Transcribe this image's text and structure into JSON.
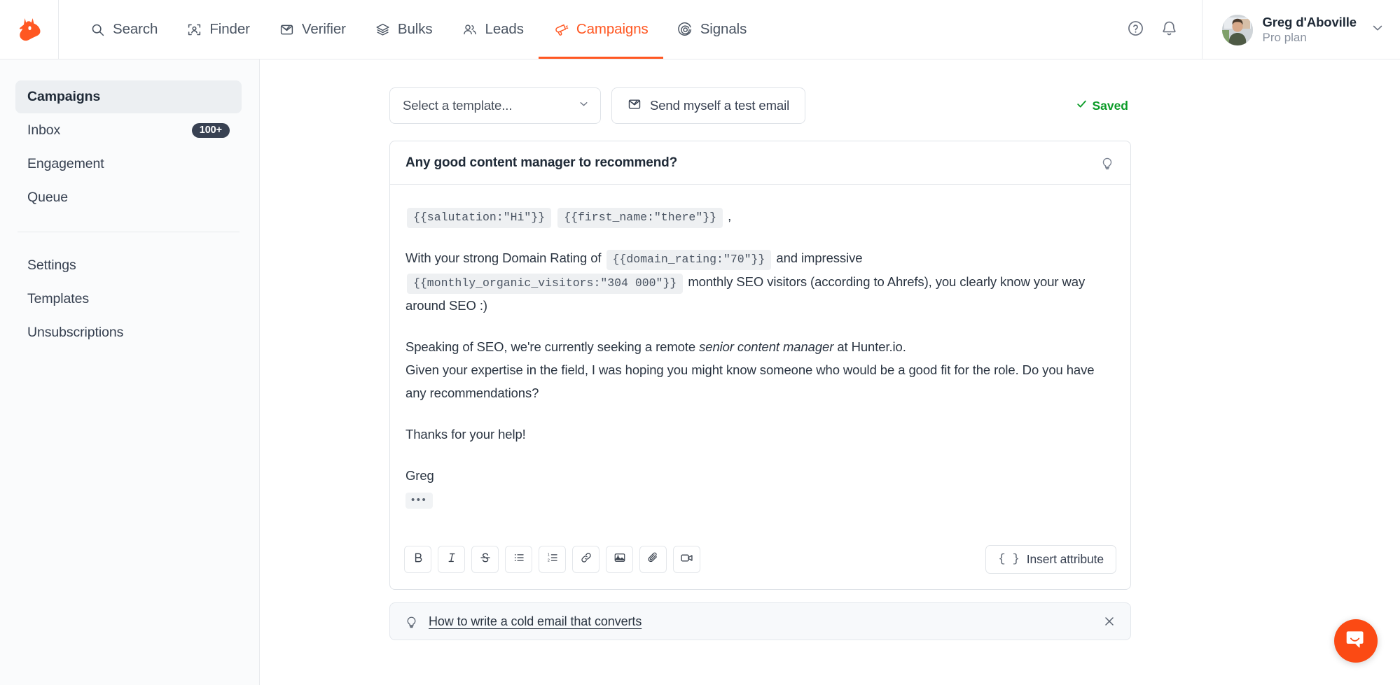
{
  "brand": {
    "name": "Hunter",
    "logo_icon": "hunter-fox-logo",
    "color": "#ff5722"
  },
  "topnav": {
    "items": [
      {
        "label": "Search",
        "icon": "search-icon"
      },
      {
        "label": "Finder",
        "icon": "person-frame-icon"
      },
      {
        "label": "Verifier",
        "icon": "envelope-check-icon"
      },
      {
        "label": "Bulks",
        "icon": "layers-icon"
      },
      {
        "label": "Leads",
        "icon": "people-icon"
      },
      {
        "label": "Campaigns",
        "icon": "megaphone-icon",
        "active": true
      },
      {
        "label": "Signals",
        "icon": "radar-icon"
      }
    ],
    "help_icon": "question-circle-icon",
    "notifications_icon": "bell-icon",
    "user": {
      "name": "Greg d'Aboville",
      "plan": "Pro plan",
      "avatar_icon": "user-avatar",
      "chevron_icon": "chevron-down-icon"
    }
  },
  "sidebar": {
    "items": [
      {
        "label": "Campaigns",
        "active": true
      },
      {
        "label": "Inbox",
        "badge": "100+"
      },
      {
        "label": "Engagement"
      },
      {
        "label": "Queue"
      }
    ],
    "items2": [
      {
        "label": "Settings"
      },
      {
        "label": "Templates"
      },
      {
        "label": "Unsubscriptions"
      }
    ]
  },
  "toolbar": {
    "template_select_value": "Select a template...",
    "template_select_chevron": "chevron-down-icon",
    "test_email_label": "Send myself a test email",
    "test_email_icon": "envelope-check-icon",
    "saved_label": "Saved",
    "saved_check_icon": "check-icon",
    "saved_color": "#0c9c28"
  },
  "editor": {
    "subject": "Any good content manager to recommend?",
    "bulb_icon": "lightbulb-icon",
    "greeting": {
      "token1": "{{salutation:\"Hi\"}}",
      "token2": "{{first_name:\"there\"}}",
      "comma": ","
    },
    "para_dr": {
      "pre": "With your strong Domain Rating of",
      "token_rating": "{{domain_rating:\"70\"}}",
      "mid": "and impressive",
      "token_visitors": "{{monthly_organic_visitors:\"304 000\"}}",
      "post": "monthly SEO visitors (according to Ahrefs), you clearly know your way around SEO :)"
    },
    "para_seo": {
      "pre": "Speaking of SEO, we're currently seeking a remote ",
      "italic": "senior content manager",
      "post": " at Hunter.io."
    },
    "para_ask": "Given your expertise in the field, I was hoping you might know someone who would be a good fit for the role. Do you have any recommendations?",
    "para_thanks": "Thanks for your help!",
    "signoff_name": "Greg",
    "signature_placeholder": "•••",
    "format_buttons": [
      {
        "name": "bold-button",
        "label": "B",
        "icon": "bold-icon"
      },
      {
        "name": "italic-button",
        "label": "I",
        "icon": "italic-icon"
      },
      {
        "name": "strikethrough-button",
        "label": "S",
        "icon": "strikethrough-icon"
      },
      {
        "name": "bullet-list-button",
        "label": "",
        "icon": "bullet-list-icon"
      },
      {
        "name": "numbered-list-button",
        "label": "",
        "icon": "numbered-list-icon"
      },
      {
        "name": "link-button",
        "label": "",
        "icon": "link-icon"
      },
      {
        "name": "image-button",
        "label": "",
        "icon": "image-icon"
      },
      {
        "name": "attachment-button",
        "label": "",
        "icon": "paperclip-icon"
      },
      {
        "name": "video-button",
        "label": "",
        "icon": "video-camera-icon"
      }
    ],
    "insert_attribute_label": "Insert attribute",
    "insert_attribute_icon": "curly-braces-icon"
  },
  "tip": {
    "icon": "lightbulb-icon",
    "link_label": "How to write a cold email that converts",
    "close_icon": "close-icon"
  },
  "intercom": {
    "icon": "intercom-chat-icon",
    "color": "#fb4a14"
  }
}
